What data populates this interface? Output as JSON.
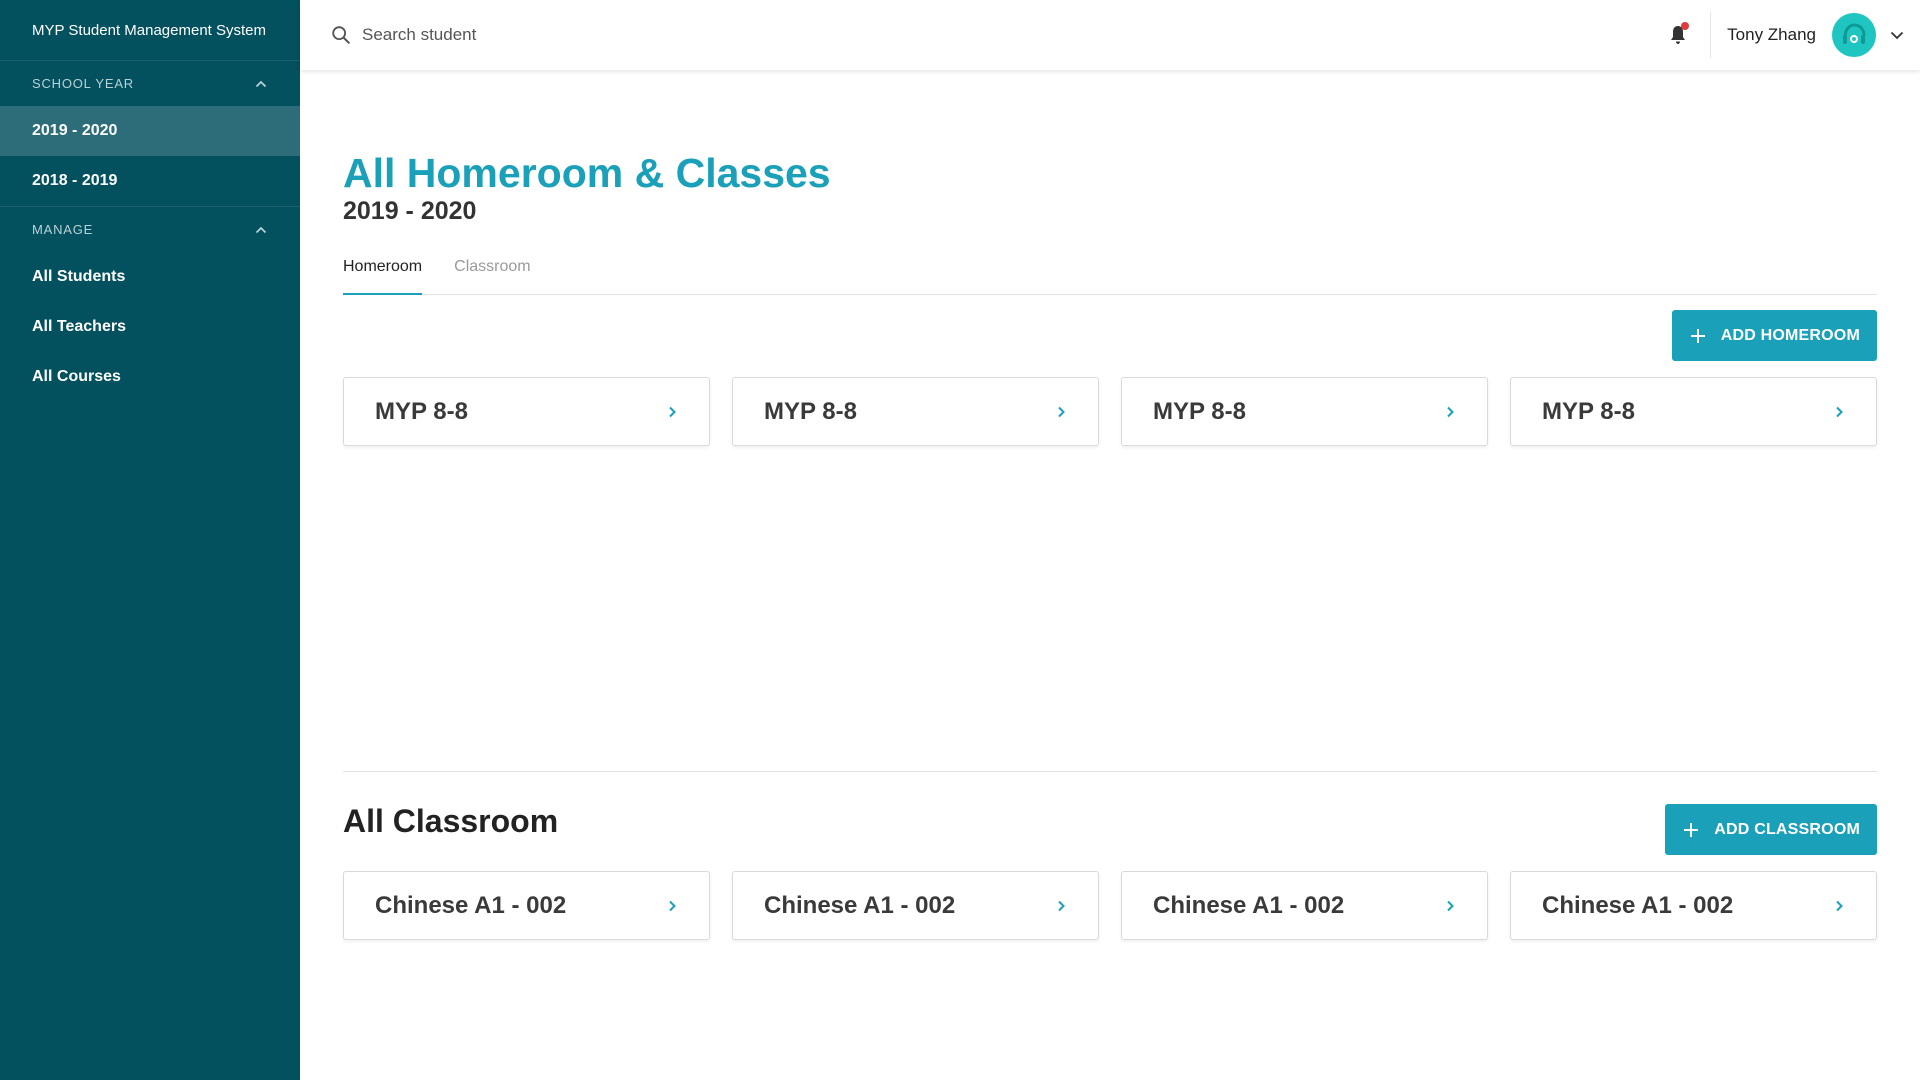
{
  "app": {
    "title": "MYP Student Management System"
  },
  "sidebar": {
    "school_year": {
      "header": "SCHOOL YEAR",
      "items": [
        {
          "label": "2019 - 2020",
          "active": true
        },
        {
          "label": "2018 - 2019",
          "active": false
        }
      ]
    },
    "manage": {
      "header": "MANAGE",
      "items": [
        {
          "label": "All Students"
        },
        {
          "label": "All Teachers"
        },
        {
          "label": "All Courses"
        }
      ]
    }
  },
  "topbar": {
    "search_placeholder": "Search student",
    "user_name": "Tony Zhang",
    "notification_dot": true
  },
  "main": {
    "title": "All Homeroom & Classes",
    "subtitle": "2019 - 2020",
    "tabs": [
      {
        "label": "Homeroom",
        "active": true
      },
      {
        "label": "Classroom",
        "active": false
      }
    ],
    "add_homeroom_label": "ADD HOMEROOM",
    "homerooms": [
      "MYP 8-8",
      "MYP 8-8",
      "MYP 8-8",
      "MYP 8-8"
    ],
    "classroom_section_title": "All Classroom",
    "add_classroom_label": "ADD CLASSROOM",
    "classrooms": [
      "Chinese A1 - 002",
      "Chinese A1 - 002",
      "Chinese A1 - 002",
      "Chinese A1 - 002"
    ]
  },
  "colors": {
    "sidebar_bg": "#03505e",
    "sidebar_active": "#2c6d79",
    "accent": "#1aa0b8",
    "avatar": "#1fc6c1",
    "notification": "#e03a3a"
  },
  "icons": {
    "search": "search-icon",
    "bell": "bell-icon",
    "caret": "chevron-down-icon",
    "collapse": "chevron-up-icon",
    "card_arrow": "chevron-right-icon",
    "add": "plus-icon"
  }
}
